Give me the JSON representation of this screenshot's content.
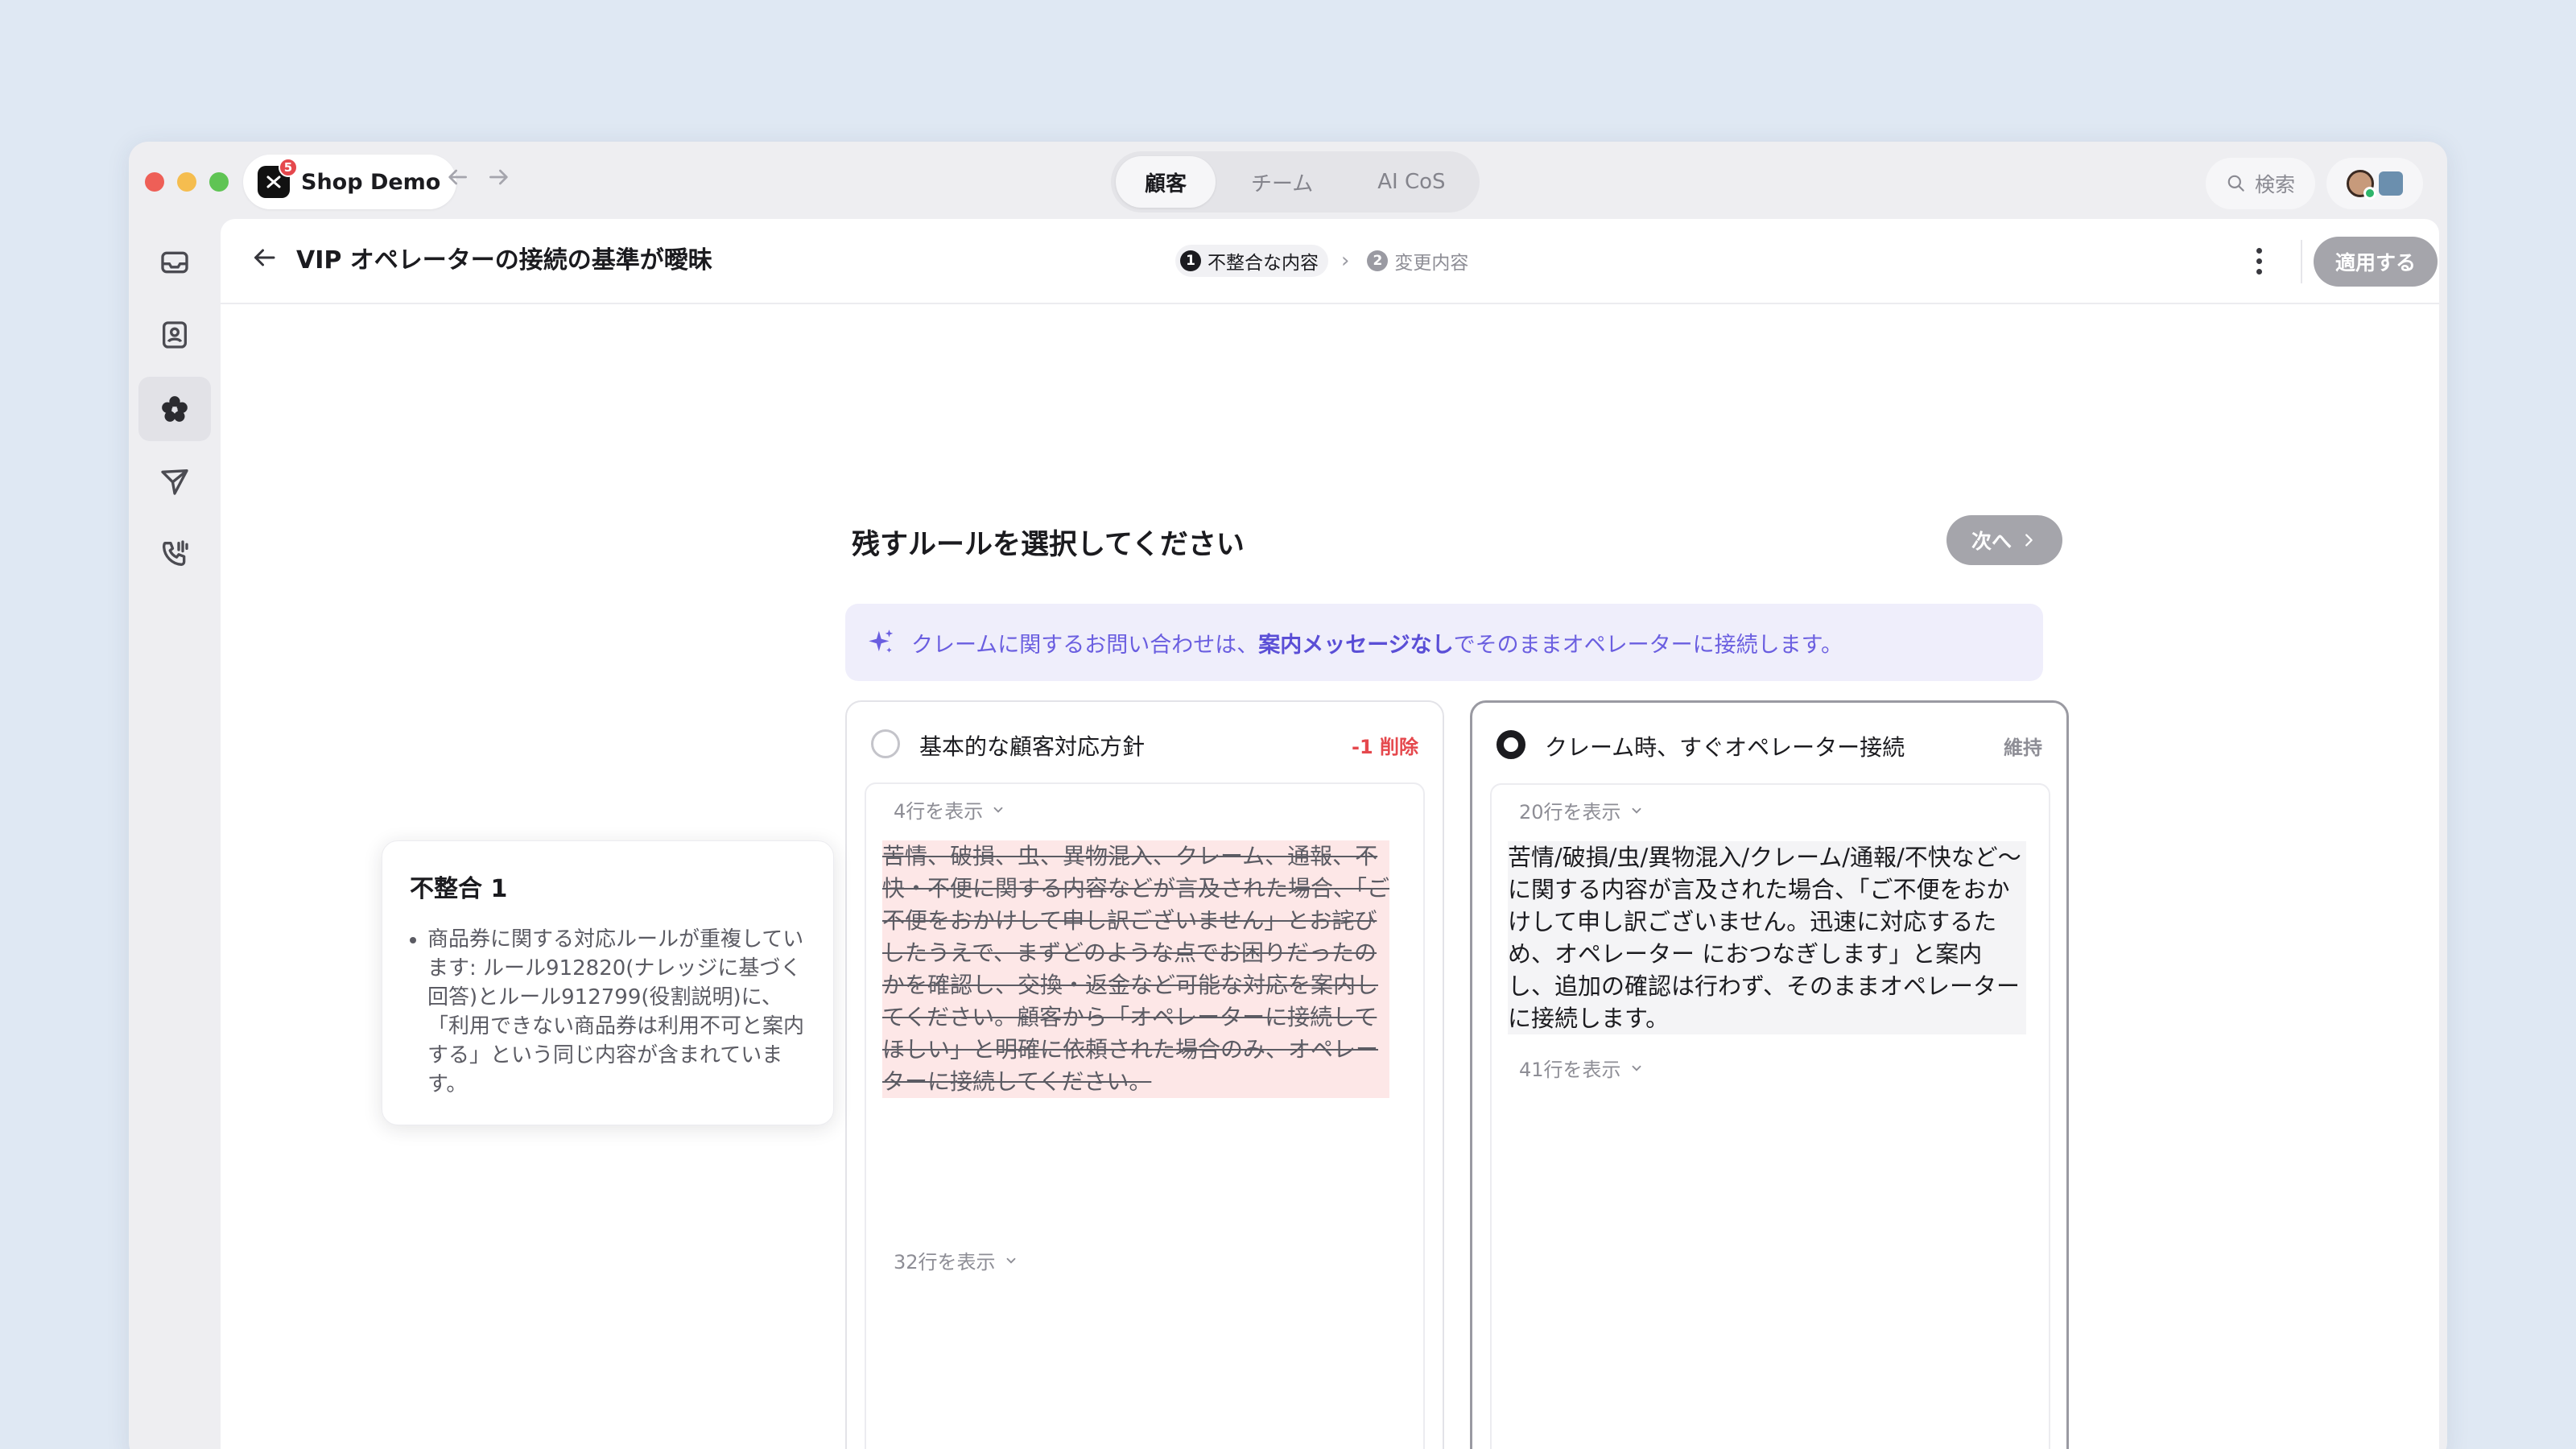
{
  "app": {
    "name": "Shop Demo",
    "badge_count": "5"
  },
  "tabs": [
    {
      "label": "顧客",
      "active": true
    },
    {
      "label": "チーム",
      "active": false
    },
    {
      "label": "AI CoS",
      "active": false
    }
  ],
  "search": {
    "label": "検索"
  },
  "sidebar": {
    "items": [
      {
        "icon": "inbox-icon"
      },
      {
        "icon": "contacts-icon"
      },
      {
        "icon": "ai-flower-icon",
        "active": true
      },
      {
        "icon": "send-icon"
      },
      {
        "icon": "phone-icon"
      }
    ]
  },
  "header": {
    "title": "VIP オペレーターの接続の基準が曖昧",
    "steps": [
      {
        "num": "1",
        "label": "不整合な内容",
        "active": true
      },
      {
        "num": "2",
        "label": "変更内容",
        "active": false
      }
    ],
    "apply_label": "適用する"
  },
  "content": {
    "section_title": "残すルールを選択してください",
    "next_label": "次へ",
    "banner": {
      "before": "クレームに関するお問い合わせは、",
      "emphasis": "案内メッセージなし",
      "after": "でそのままオペレーターに接続します。"
    }
  },
  "cards": {
    "left": {
      "title": "基本的な顧客対応方針",
      "tag": "-1 削除",
      "show_top": "4行を表示",
      "rule_text": "苦情、破損、虫、異物混入、クレーム、通報、不快・不便に関する内容などが言及された場合、「ご不便をおかけして申し訳ございません」とお詫びしたうえで、まずどのような点でお困りだったのかを確認し、交換・返金など可能な対応を案内してください。顧客から「オペレーターに接続してほしい」と明確に依頼された場合のみ、オペレーターに接続してください。",
      "show_bottom": "32行を表示",
      "selected": false
    },
    "right": {
      "title": "クレーム時、すぐオペレーター接続",
      "tag": "維持",
      "show_top": "20行を表示",
      "rule_text": "苦情/破損/虫/異物混入/クレーム/通報/不快など〜に関する内容が言及された場合、「ご不便をおかけして申し訳ございません。迅速に対応するため、オペレーター におつなぎします」と案内し、追加の確認は行わず、そのままオペレーターに接続します。",
      "show_bottom": "41行を表示",
      "selected": true
    }
  },
  "issue": {
    "title": "不整合 1",
    "text": "商品券に関する対応ルールが重複しています: ルール912820(ナレッジに基づく回答)とルール912799(役割説明)に、「利用できない商品券は利用不可と案内する」という同じ内容が含まれています。"
  },
  "colors": {
    "accent_purple": "#6a5ee0",
    "delete_red": "#e5484d",
    "deleted_bg": "#fde7e7",
    "disabled_button": "#a5a5ab"
  }
}
